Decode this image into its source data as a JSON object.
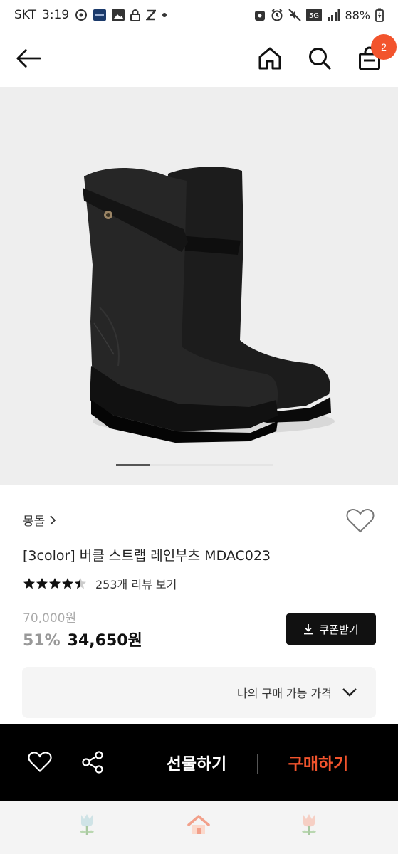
{
  "status_bar": {
    "carrier": "SKT",
    "time": "3:19",
    "battery": "88%",
    "network": "5G",
    "left_icons": [
      "data-saver-icon",
      "app-notification-icon",
      "photo-icon",
      "lock-icon",
      "z-app-icon",
      "dot-icon"
    ],
    "right_icons": [
      "lock-app-icon",
      "alarm-icon",
      "mute-icon",
      "5g-icon",
      "signal-icon",
      "battery-icon"
    ]
  },
  "header": {
    "back_icon": "arrow-left-icon",
    "home_icon": "home-icon",
    "search_icon": "search-icon",
    "cart_icon": "shopping-bag-icon",
    "cart_count": "2",
    "badge_color": "#f2542d"
  },
  "gallery": {
    "image_icon": "rain-boots-product-image",
    "current_index": 1,
    "total": 4
  },
  "product": {
    "brand": "몽돌",
    "brand_chevron": "›",
    "title": "[3color] 버클 스트랩 레인부츠 MDAC023",
    "rating": 4.5,
    "rating_max": 5,
    "review_text": "253개 리뷰 보기",
    "original_price": "70,000원",
    "discount": "51%",
    "sale_price": "34,650원",
    "wishlist_icon": "heart-outline-icon"
  },
  "coupon": {
    "label": "쿠폰받기",
    "icon": "download-icon"
  },
  "my_price": {
    "label": "나의 구매 가능 가격",
    "icon": "chevron-down-icon"
  },
  "action_bar": {
    "wish_icon": "heart-outline-icon",
    "share_icon": "share-icon",
    "gift_label": "선물하기",
    "buy_label": "구매하기",
    "buy_color": "#f2542d"
  },
  "bottom_nav": {
    "left_icon": "tulip-icon",
    "center_icon": "home-icon",
    "right_icon": "tulip-pink-icon"
  }
}
